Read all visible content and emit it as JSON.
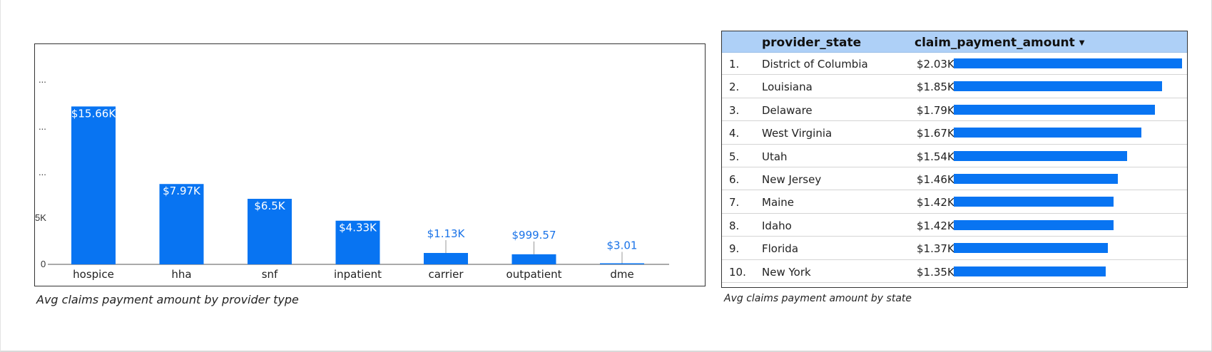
{
  "bar_chart": {
    "caption": "Avg claims payment amount by provider type",
    "y_tick_labels": [
      "0",
      "5K",
      "...",
      "...",
      "..."
    ]
  },
  "state_table": {
    "caption": "Avg claims payment amount by state",
    "headers": {
      "state": "provider_state",
      "amount": "claim_payment_amount"
    },
    "sort_icon": "sort-descending-icon",
    "rows": [
      {
        "rank": "1.",
        "state": "District of Columbia",
        "amount": "$2.03K",
        "value": 2030
      },
      {
        "rank": "2.",
        "state": "Louisiana",
        "amount": "$1.85K",
        "value": 1850
      },
      {
        "rank": "3.",
        "state": "Delaware",
        "amount": "$1.79K",
        "value": 1790
      },
      {
        "rank": "4.",
        "state": "West Virginia",
        "amount": "$1.67K",
        "value": 1670
      },
      {
        "rank": "5.",
        "state": "Utah",
        "amount": "$1.54K",
        "value": 1540
      },
      {
        "rank": "6.",
        "state": "New Jersey",
        "amount": "$1.46K",
        "value": 1460
      },
      {
        "rank": "7.",
        "state": "Maine",
        "amount": "$1.42K",
        "value": 1420
      },
      {
        "rank": "8.",
        "state": "Idaho",
        "amount": "$1.42K",
        "value": 1420
      },
      {
        "rank": "9.",
        "state": "Florida",
        "amount": "$1.37K",
        "value": 1370
      },
      {
        "rank": "10.",
        "state": "New York",
        "amount": "$1.35K",
        "value": 1350
      }
    ]
  },
  "colors": {
    "bar": "#0874f2",
    "label_outside": "#1a73e8",
    "header": "#aed0f7"
  },
  "chart_data": {
    "type": "bar",
    "categories": [
      "hospice",
      "hha",
      "snf",
      "inpatient",
      "carrier",
      "outpatient",
      "dme"
    ],
    "values": [
      15660,
      7970,
      6500,
      4330,
      1130,
      999.57,
      3.01
    ],
    "data_labels": [
      "$15.66K",
      "$7.97K",
      "$6.5K",
      "$4.33K",
      "$1.13K",
      "$999.57",
      "$3.01"
    ],
    "title": "",
    "xlabel": "",
    "ylabel": "",
    "ylim": [
      0,
      20000
    ],
    "grid": false,
    "legend": "none"
  }
}
